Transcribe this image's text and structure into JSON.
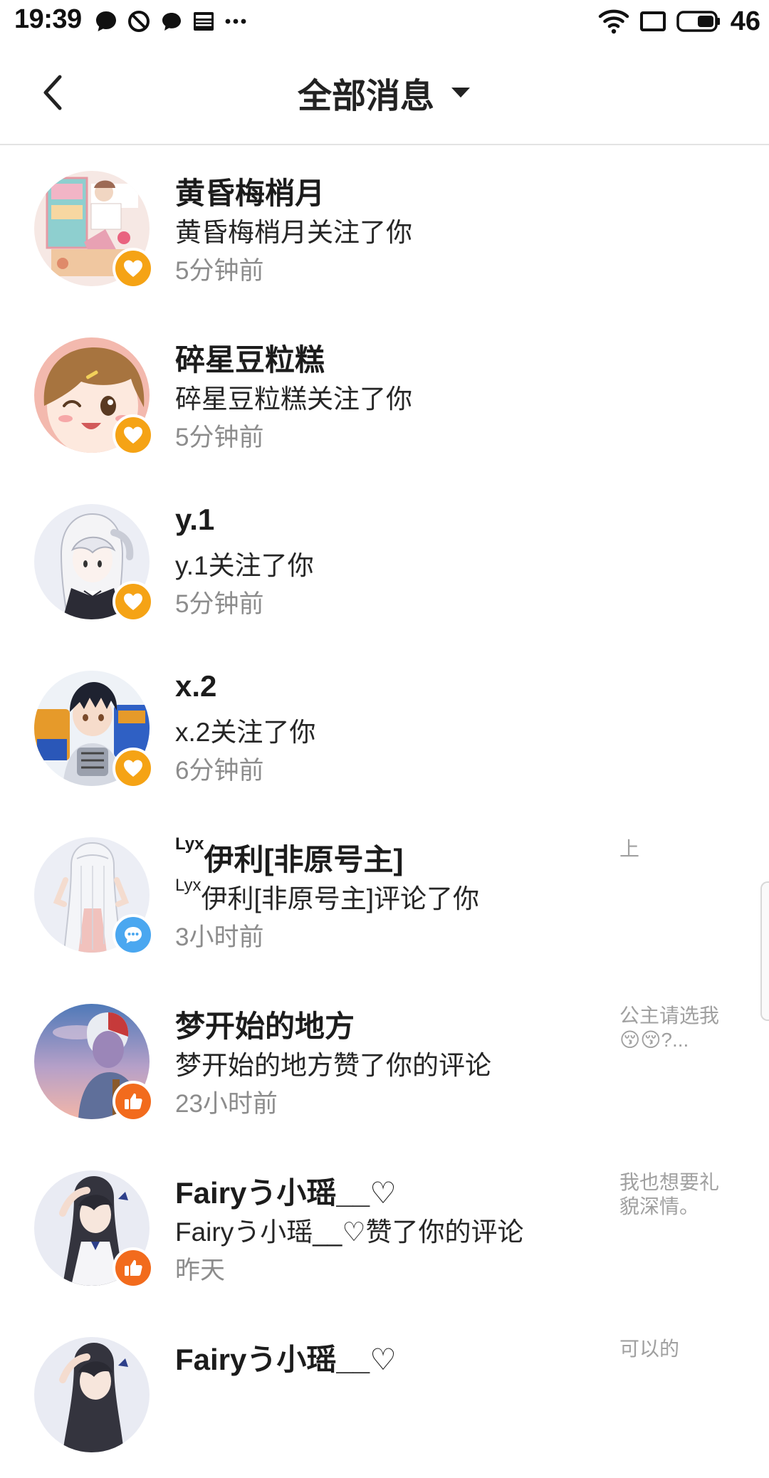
{
  "status_bar": {
    "time": "19:39",
    "battery_level": "46",
    "icons_left": [
      "chat-bubble-icon",
      "do-not-disturb-icon",
      "message-icon",
      "news-icon",
      "more-dots-icon"
    ],
    "icons_right": [
      "wifi-icon",
      "screen-icon",
      "battery-icon"
    ]
  },
  "header": {
    "title": "全部消息",
    "back_icon": "chevron-left-icon",
    "dropdown_icon": "caret-down-icon"
  },
  "colors": {
    "follow_badge": "#f5a315",
    "comment_badge": "#4aa7f0",
    "like_badge": "#f26b1d",
    "time_text": "#8c8c8c",
    "snippet_text": "#a0a0a0"
  },
  "messages": [
    {
      "name": "黄昏梅梢月",
      "name_prefix": "",
      "text_prefix": "",
      "text": "黄昏梅梢月关注了你",
      "time": "5分钟前",
      "snippet": "",
      "badge": "follow",
      "badge_icon": "heart-icon"
    },
    {
      "name": "碎星豆粒糕",
      "name_prefix": "",
      "text_prefix": "",
      "text": "碎星豆粒糕关注了你",
      "time": "5分钟前",
      "snippet": "",
      "badge": "follow",
      "badge_icon": "heart-icon"
    },
    {
      "name": "y.1",
      "name_prefix": "",
      "text_prefix": "",
      "text": "y.1关注了你",
      "time": "5分钟前",
      "snippet": "",
      "badge": "follow",
      "badge_icon": "heart-icon"
    },
    {
      "name": "x.2",
      "name_prefix": "",
      "text_prefix": "",
      "text": "x.2关注了你",
      "time": "6分钟前",
      "snippet": "",
      "badge": "follow",
      "badge_icon": "heart-icon"
    },
    {
      "name": "伊利[非原号主]",
      "name_prefix": "Lyx",
      "text_prefix": "Lyx",
      "text": "伊利[非原号主]评论了你",
      "time": "3小时前",
      "snippet": "上",
      "badge": "comment",
      "badge_icon": "comment-icon"
    },
    {
      "name": "梦开始的地方",
      "name_prefix": "",
      "text_prefix": "",
      "text": "梦开始的地方赞了你的评论",
      "time": "23小时前",
      "snippet": "公主请选我😚😚?...",
      "badge": "like",
      "badge_icon": "thumbs-up-icon"
    },
    {
      "name": "Fairyう小瑶__♡",
      "name_prefix": "",
      "text_prefix": "",
      "text": "Fairyう小瑶__♡赞了你的评论",
      "time": "昨天",
      "snippet": "我也想要礼貌深情。",
      "badge": "like",
      "badge_icon": "thumbs-up-icon"
    },
    {
      "name": "Fairyう小瑶__♡",
      "name_prefix": "",
      "text_prefix": "",
      "text": "",
      "time": "",
      "snippet": "可以的",
      "badge": "like",
      "badge_icon": "thumbs-up-icon"
    }
  ]
}
